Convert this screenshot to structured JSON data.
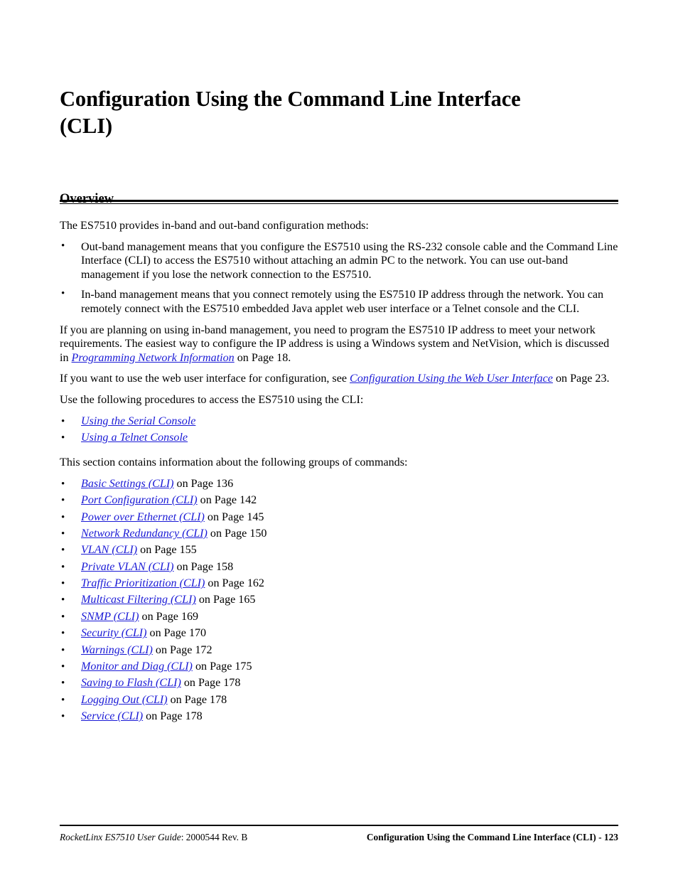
{
  "page": {
    "chapter_title_line1": "Configuration Using the Command Line Interface",
    "chapter_title_line2": "(CLI)",
    "link_color": "#1a1ad6"
  },
  "section": {
    "heading": "Overview"
  },
  "body": {
    "intro_paragraph": "The ES7510 provides in-band and out-band configuration methods:",
    "method_bullets": [
      "Out-band management means that you configure the ES7510 using the RS-232 console cable and the Command Line Interface (CLI) to access the ES7510 without attaching an admin PC to the network. You can use out-band management if you lose the network connection to the ES7510.",
      "In-band management means that you connect remotely using the ES7510 IP address through the network. You can remotely connect with the ES7510 embedded Java applet web user interface or a Telnet console and the CLI."
    ],
    "inband_para_before_link": "If you are planning on using in-band management, you need to program the ES7510 IP address to meet your network requirements. The easiest way to configure the IP address is using a Windows system and NetVision, which is discussed in ",
    "inband_para_link": "Programming Network Information",
    "inband_para_after_link": " on Page 18.",
    "webui_para_before_link": "If you want to use the web user interface for configuration, see ",
    "webui_para_link": "Configuration Using the Web User Interface",
    "webui_para_after_link": " on Page 23.",
    "procedures_intro": "Use the following procedures to access the ES7510 using the CLI:",
    "procedure_links": [
      "Using the Serial Console",
      "Using a Telnet Console"
    ],
    "commands_intro": "This section contains information about the following groups of commands:",
    "command_groups": [
      {
        "link": "Basic Settings (CLI)",
        "suffix": " on Page 136"
      },
      {
        "link": "Port Configuration (CLI)",
        "suffix": " on Page 142"
      },
      {
        "link": "Power over Ethernet (CLI)",
        "suffix": " on Page 145"
      },
      {
        "link": "Network Redundancy (CLI)",
        "suffix": " on Page 150"
      },
      {
        "link": "VLAN (CLI)",
        "suffix": " on Page 155"
      },
      {
        "link": "Private VLAN (CLI)",
        "suffix": " on Page 158"
      },
      {
        "link": "Traffic Prioritization (CLI)",
        "suffix": " on Page 162"
      },
      {
        "link": "Multicast Filtering (CLI)",
        "suffix": " on Page 165"
      },
      {
        "link": "SNMP (CLI)",
        "suffix": " on Page 169"
      },
      {
        "link": "Security (CLI)",
        "suffix": " on Page 170"
      },
      {
        "link": "Warnings (CLI)",
        "suffix": " on Page 172"
      },
      {
        "link": "Monitor and Diag (CLI)",
        "suffix": " on Page 175"
      },
      {
        "link": "Saving to Flash (CLI)",
        "suffix": " on Page 178"
      },
      {
        "link": "Logging Out (CLI)",
        "suffix": " on Page 178"
      },
      {
        "link": "Service (CLI)",
        "suffix": " on Page 178"
      }
    ],
    "bullet_glyph": "•"
  },
  "footer": {
    "left_italic": "RocketLinx ES7510  User Guide",
    "left_regular": ": 2000544 Rev. B",
    "right": "Configuration Using the Command Line Interface (CLI) - 123"
  }
}
